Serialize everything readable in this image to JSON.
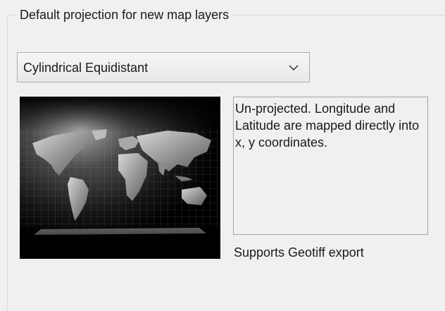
{
  "group": {
    "title": "Default projection for new map layers"
  },
  "projection_select": {
    "selected": "Cylindrical Equidistant",
    "icon": "chevron-down-icon"
  },
  "preview": {
    "icon": "world-map-projection-image"
  },
  "description": {
    "text": "Un-projected. Longitude and Latitude are mapped directly into x, y coordinates."
  },
  "support": {
    "text": "Supports Geotiff export"
  }
}
